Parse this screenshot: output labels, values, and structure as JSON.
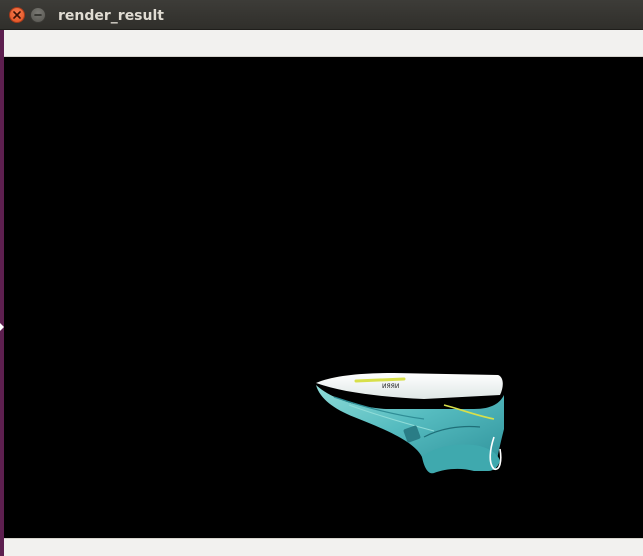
{
  "window": {
    "title": "render_result",
    "close_icon": "close-icon",
    "minimize_icon": "minimize-icon"
  },
  "canvas": {
    "background": "#000000",
    "rendered_object": "shoe",
    "object_colors": {
      "upper": "#5fc4c3",
      "sole": "#f4f6f5",
      "accent": "#d8e04a",
      "shadow": "#2f8d96"
    },
    "object_print": "ИЯЯИ"
  },
  "colors": {
    "titlebar": "#34332f",
    "close": "#e95420",
    "minimize": "#6c6b66",
    "frame": "#f2f1ef",
    "launcher_edge": "#5d1f4f"
  }
}
